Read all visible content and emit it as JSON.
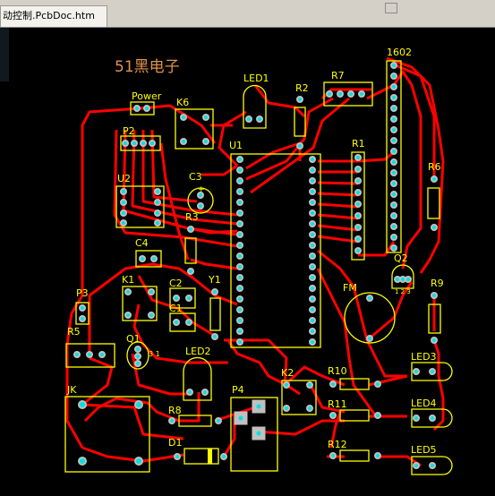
{
  "document_tab": {
    "title": "动控制.PcbDoc.htm"
  },
  "board": {
    "title": "51黑电子",
    "colors": {
      "trace": "#ff0000",
      "silk": "#ffff00",
      "pad": "#c0c0c0",
      "title": "#e0934a",
      "background": "#000000"
    },
    "designators": {
      "power": "Power",
      "k6": "K6",
      "led1": "LED1",
      "r2": "R2",
      "r7": "R7",
      "lcd1602": "1602",
      "p2": "P2",
      "u1": "U1",
      "r1": "R1",
      "c3": "C3",
      "c3_plus": "+",
      "u2": "U2",
      "r6": "R6",
      "r3": "R3",
      "c4": "C4",
      "q2": "Q2",
      "q2_pins": "1 2 3",
      "p3": "P3",
      "k1": "K1",
      "c2": "C2",
      "y1": "Y1",
      "fm": "FM",
      "r9": "R9",
      "c1": "C1",
      "r5": "R5",
      "q1": "Q1",
      "q1_pins": "3\n1",
      "led2": "LED2",
      "led3": "LED3",
      "r10": "R10",
      "k2": "K2",
      "jk": "JK",
      "p4": "P4",
      "r11": "R11",
      "led4": "LED4",
      "r8": "R8",
      "d1": "D1",
      "r12": "R12",
      "led5": "LED5"
    }
  }
}
